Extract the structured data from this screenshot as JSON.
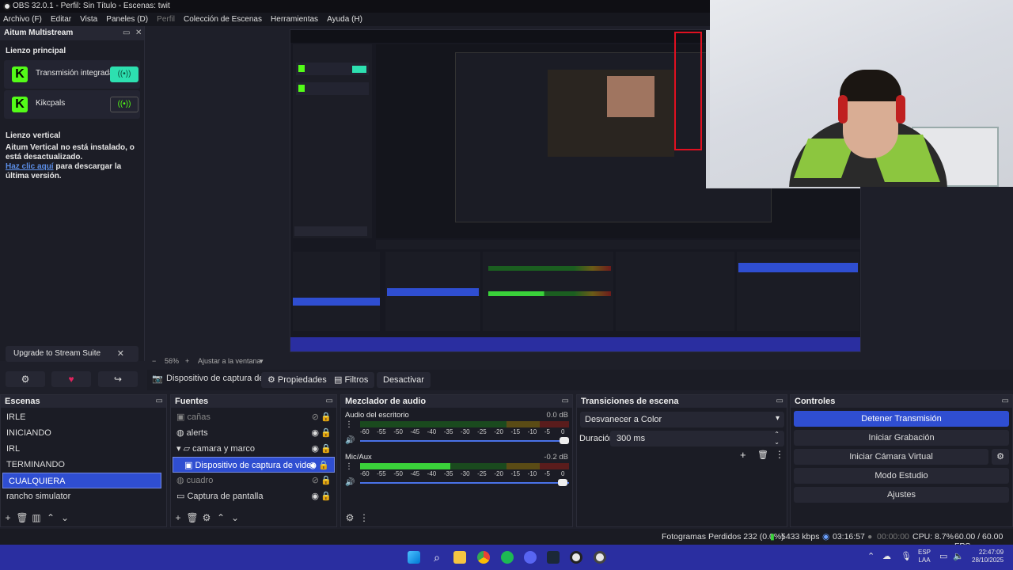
{
  "window": {
    "title": "OBS 32.0.1 - Perfil: Sin Título - Escenas: twit"
  },
  "menu": [
    "Archivo (F)",
    "Editar",
    "Vista",
    "Paneles (D)",
    "Perfil",
    "Colección de Escenas",
    "Herramientas",
    "Ayuda (H)"
  ],
  "multistream": {
    "title": "Aitum Multistream",
    "main_canvas": "Lienzo principal",
    "outputs": [
      {
        "label": "Transmisión integrada",
        "active": true
      },
      {
        "label": "Kikcpals",
        "active": false
      }
    ],
    "vertical_canvas": "Lienzo vertical",
    "vertical_msg": "Aitum Vertical no está instalado, o está desactualizado.",
    "link_text": "Haz clic aquí",
    "link_rest": " para descargar la última versión.",
    "upgrade": "Upgrade to Stream Suite"
  },
  "zoom": {
    "level": "56%",
    "fit": "Ajustar a la ventana"
  },
  "source_toolbar": {
    "source": "Dispositivo de captura de v",
    "properties": "Propiedades",
    "filters": "Filtros",
    "deactivate": "Desactivar"
  },
  "scenes": {
    "title": "Escenas",
    "items": [
      "IRLE",
      "INICIANDO",
      "IRL",
      "TERMINANDO",
      "CUALQUIERA",
      "rancho simulator"
    ],
    "selected": 4
  },
  "sources": {
    "title": "Fuentes",
    "items": [
      {
        "label": "cañas",
        "icon": "camera-icon",
        "visible": false,
        "indent": 0
      },
      {
        "label": "alerts",
        "icon": "globe-icon",
        "visible": true,
        "indent": 0
      },
      {
        "label": "camara y marco",
        "icon": "folder-icon",
        "visible": true,
        "indent": 0
      },
      {
        "label": "Dispositivo de captura de video",
        "icon": "camera-icon",
        "visible": true,
        "indent": 1
      },
      {
        "label": "cuadro",
        "icon": "globe-icon",
        "visible": false,
        "indent": 0
      },
      {
        "label": "Captura de pantalla",
        "icon": "monitor-icon",
        "visible": true,
        "indent": 0
      }
    ]
  },
  "mixer": {
    "title": "Mezclador de audio",
    "channels": [
      {
        "name": "Audio del escritorio",
        "db": "0.0 dB",
        "level": 0.0
      },
      {
        "name": "Mic/Aux",
        "db": "-0.2 dB",
        "level": 0.43
      }
    ],
    "ticks": [
      "-60",
      "-55",
      "-50",
      "-45",
      "-40",
      "-35",
      "-30",
      "-25",
      "-20",
      "-15",
      "-10",
      "-5",
      "0"
    ]
  },
  "transitions": {
    "title": "Transiciones de escena",
    "selected": "Desvanecer a Color",
    "duration_label": "Duración",
    "duration": "300 ms"
  },
  "controls": {
    "title": "Controles",
    "buttons": [
      "Detener Transmisión",
      "Iniciar Grabación",
      "Iniciar Cámara Virtual",
      "Modo Estudio",
      "Ajustes"
    ]
  },
  "status": {
    "frames": "Fotogramas Perdidos 232 (0.0%)",
    "kbps": "5433 kbps",
    "stream_time": "03:16:57",
    "rec_time": "00:00:00",
    "cpu": "CPU: 8.7%",
    "fps": "60.00 / 60.00 FPS"
  },
  "taskbar": {
    "lang1": "ESP",
    "lang2": "LAA",
    "time": "22:47:09",
    "date": "28/10/2025"
  },
  "colors": {
    "accent": "#2f4ed1",
    "kick": "#53fc18",
    "toggle_on": "#2de0b0"
  }
}
